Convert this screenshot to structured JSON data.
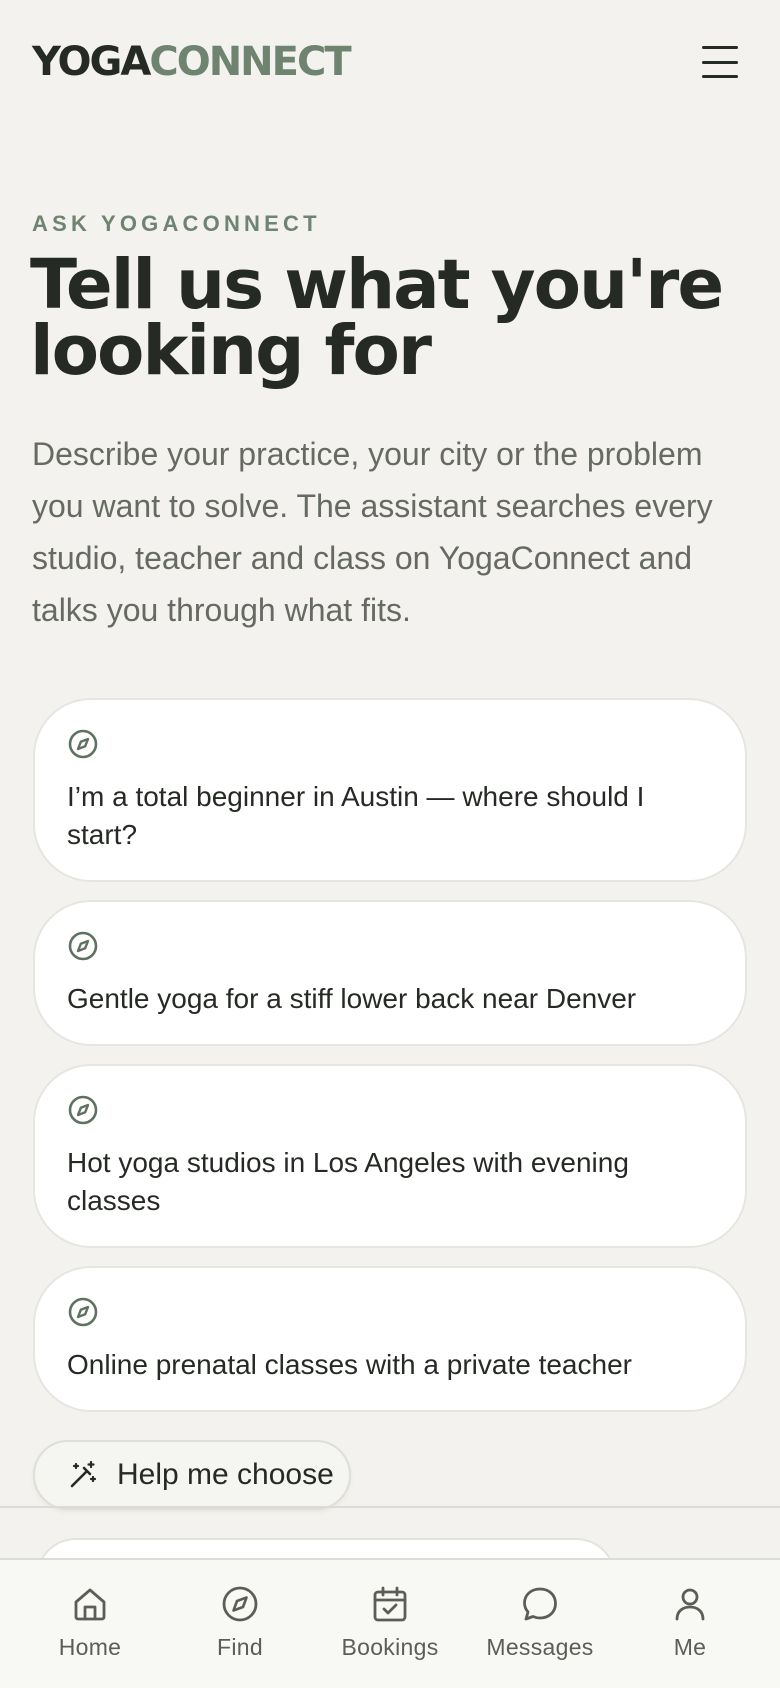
{
  "header": {
    "logo_part1": "YOGA",
    "logo_part2": "CONNECT",
    "menu_icon": "hamburger-menu-icon"
  },
  "hero": {
    "eyebrow": "ASK YOGACONNECT",
    "headline": "Tell us what you're looking for",
    "lead": "Describe your practice, your city or the problem you want to solve. The assistant searches every studio, teacher and class on YogaConnect and talks you through what fits."
  },
  "suggestions": [
    {
      "icon": "compass-icon",
      "text": "I’m a total beginner in Austin — where should I start?"
    },
    {
      "icon": "compass-icon",
      "text": "Gentle yoga for a stiff lower back near Denver"
    },
    {
      "icon": "compass-icon",
      "text": "Hot yoga studios in Los Angeles with evening classes"
    },
    {
      "icon": "compass-icon",
      "text": "Online prenatal classes with a private teacher"
    }
  ],
  "help_button": {
    "icon": "magic-wand-icon",
    "label": "Help me choose"
  },
  "bottom_nav": [
    {
      "icon": "home-icon",
      "label": "Home"
    },
    {
      "icon": "compass-icon",
      "label": "Find"
    },
    {
      "icon": "calendar-check-icon",
      "label": "Bookings"
    },
    {
      "icon": "chat-bubble-icon",
      "label": "Messages"
    },
    {
      "icon": "user-icon",
      "label": "Me"
    }
  ],
  "colors": {
    "background": "#f3f2ee",
    "ink": "#262a24",
    "accent_sage": "#6f8470",
    "muted_text": "#666a63"
  }
}
